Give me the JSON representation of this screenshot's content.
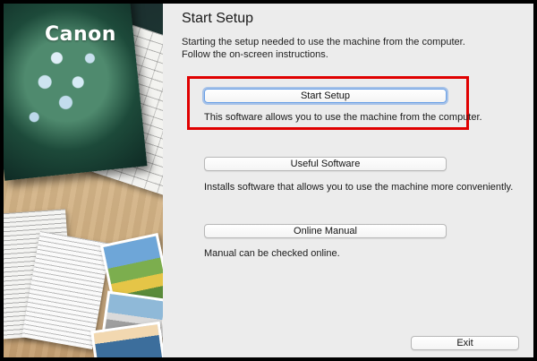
{
  "brand": {
    "logo_text": "Canon"
  },
  "header": {
    "title": "Start Setup",
    "intro_line1": "Starting the setup needed to use the machine from the computer.",
    "intro_line2": "Follow the on-screen instructions."
  },
  "options": [
    {
      "label": "Start Setup",
      "description": "This software allows you to use the machine from the computer."
    },
    {
      "label": "Useful Software",
      "description": "Installs software that allows you to use the machine more conveniently."
    },
    {
      "label": "Online Manual",
      "description": "Manual can be checked online."
    }
  ],
  "footer": {
    "exit_label": "Exit"
  },
  "colors": {
    "highlight": "#e00000",
    "focus_ring": "#6aa0e6"
  }
}
